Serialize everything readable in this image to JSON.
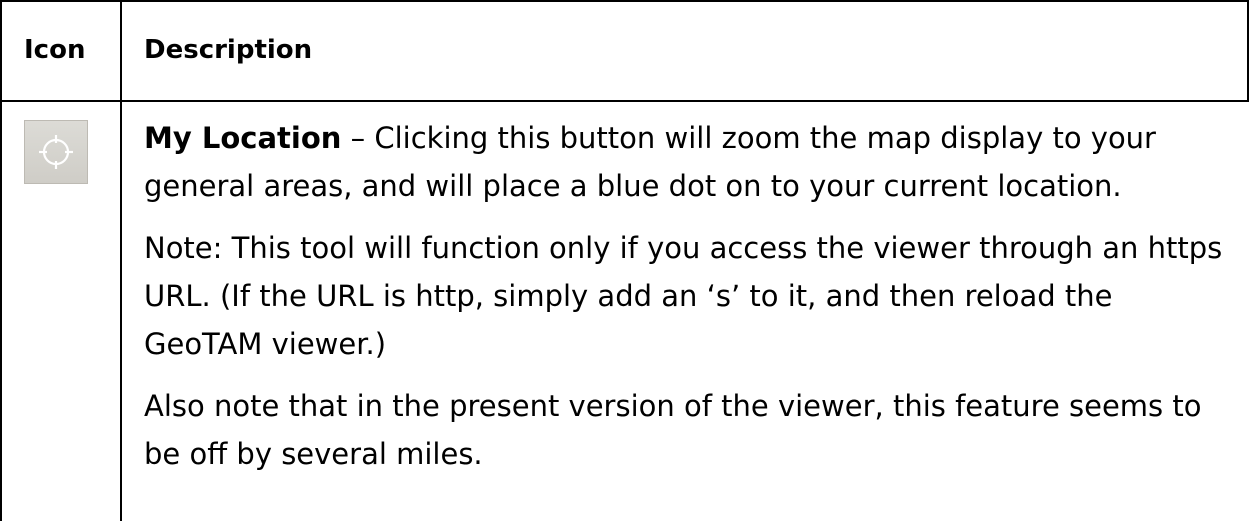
{
  "table": {
    "header": {
      "icon": "Icon",
      "description": "Description"
    },
    "row": {
      "icon_name": "locate-crosshair-icon",
      "title": "My Location",
      "paragraph1_rest": " – Clicking this button will zoom the map display to your general areas, and will place a blue dot on to your current location.",
      "paragraph2": "Note: This tool will function only if you access the viewer through an https URL.  (If the URL is http, simply add an ‘s’ to it, and then reload the GeoTAM viewer.)",
      "paragraph3": "Also note that in the present version of the viewer, this feature seems to be off by several miles."
    }
  },
  "colors": {
    "border": "#000000",
    "icon_background": "#d6d5cf",
    "icon_stroke": "#ffffff"
  }
}
